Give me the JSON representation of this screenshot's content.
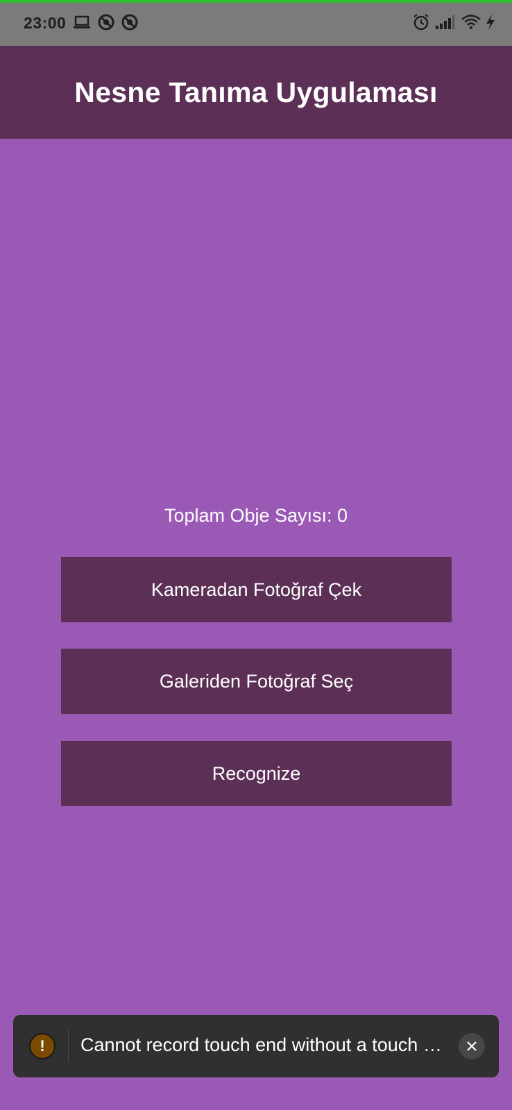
{
  "status_bar": {
    "time": "23:00",
    "left_icons": [
      "laptop-icon",
      "do-not-disturb-icon",
      "do-not-disturb-icon"
    ],
    "right_icons": [
      "alarm-icon",
      "cellular-signal-icon",
      "wifi-icon",
      "charging-bolt-icon"
    ]
  },
  "app_bar": {
    "title": "Nesne Tanıma Uygulaması"
  },
  "main": {
    "object_count_label": "Toplam Obje Sayısı: 0",
    "buttons": {
      "camera": "Kameradan Fotoğraf Çek",
      "gallery": "Galeriden Fotoğraf Seç",
      "recognize": "Recognize"
    }
  },
  "toast": {
    "icon": "warning-icon",
    "message": "Cannot record touch end without a touch …",
    "close_icon": "close-icon"
  },
  "colors": {
    "background": "#9a59b5",
    "app_bar": "#5c3056",
    "button": "#5c3056",
    "status_bar": "#7b7b7b",
    "toast": "#303030"
  }
}
